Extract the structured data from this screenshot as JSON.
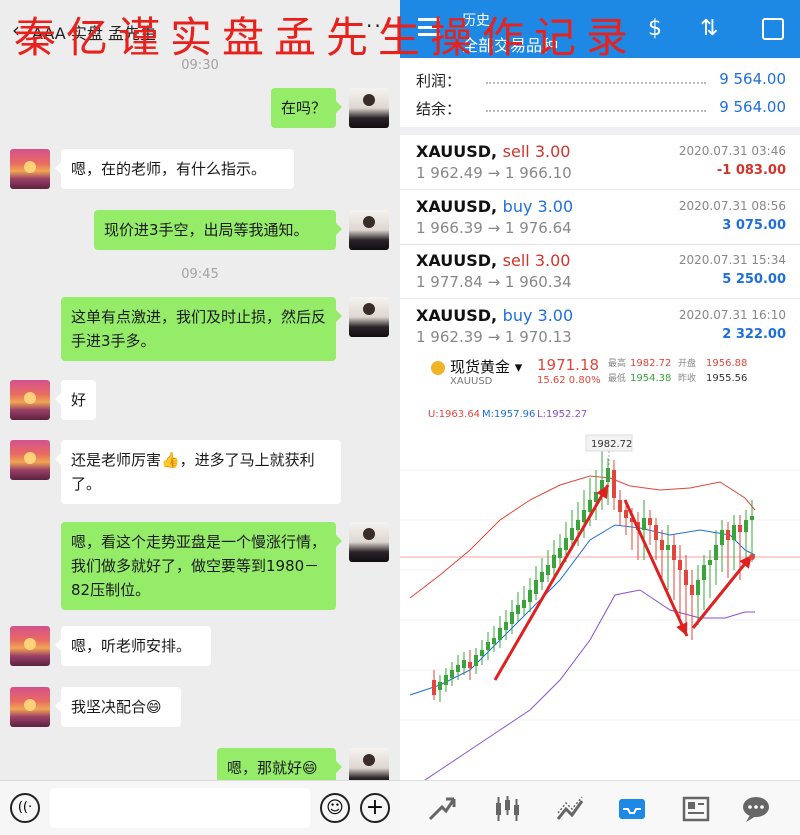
{
  "overlay_title": "秦亿谨实盘孟先生操作记录",
  "chat": {
    "title": "AAA 实盘 孟先生",
    "more": "···",
    "timestamps": [
      "09:30",
      "09:45"
    ],
    "messages": [
      {
        "side": "self",
        "text": "在吗？"
      },
      {
        "side": "other",
        "text": "嗯，在的老师，有什么指示。"
      },
      {
        "side": "self",
        "text": "现价进3手空，出局等我通知。"
      },
      {
        "side": "self",
        "text": "这单有点激进，我们及时止损，然后反手进3手多。"
      },
      {
        "side": "other",
        "text": "好"
      },
      {
        "side": "other",
        "text": "还是老师厉害👍，进多了马上就获利了。"
      },
      {
        "side": "self",
        "text": "嗯，看这个走势亚盘是一个慢涨行情，我们做多就好了，做空要等到1980－82压制位。"
      },
      {
        "side": "other",
        "text": "嗯，听老师安排。"
      },
      {
        "side": "other",
        "text": "我坚决配合😄"
      },
      {
        "side": "self",
        "text": "嗯，那就好😄"
      }
    ],
    "input": {
      "voice": "((·",
      "emoji": "☺",
      "plus": "+"
    }
  },
  "trade": {
    "header": {
      "title": "历史",
      "subtitle": "全部交易品种",
      "dollar": "$",
      "sort": "⇅"
    },
    "summary": [
      {
        "label": "利润：",
        "value": "9 564.00"
      },
      {
        "label": "结余：",
        "value": "9 564.00"
      }
    ],
    "rows": [
      {
        "symbol": "XAUUSD,",
        "side": "sell",
        "lots": "3.00",
        "open": "1 962.49",
        "close": "1 966.10",
        "date": "2020.07.31 03:46",
        "pl": "-1 083.00",
        "pl_sign": "neg"
      },
      {
        "symbol": "XAUUSD,",
        "side": "buy",
        "lots": "3.00",
        "open": "1 966.39",
        "close": "1 976.64",
        "date": "2020.07.31 08:56",
        "pl": "3 075.00",
        "pl_sign": "pos"
      },
      {
        "symbol": "XAUUSD,",
        "side": "sell",
        "lots": "3.00",
        "open": "1 977.84",
        "close": "1 960.34",
        "date": "2020.07.31 15:34",
        "pl": "5 250.00",
        "pl_sign": "pos"
      },
      {
        "symbol": "XAUUSD,",
        "side": "buy",
        "lots": "3.00",
        "open": "1 962.39",
        "close": "1 970.13",
        "date": "2020.07.31 16:10",
        "pl": "2 322.00",
        "pl_sign": "pos"
      }
    ],
    "quote": {
      "name": "现货黄金",
      "code": "XAUUSD",
      "price": "1971.18",
      "change": "15.62",
      "change_pct": "0.80%",
      "high_label": "最高",
      "high": "1982.72",
      "open_label": "开盘",
      "open": "1956.88",
      "low_label": "最低",
      "low": "1954.38",
      "prev_label": "昨收",
      "prev": "1955.56",
      "boll_u": "U:1963.64",
      "boll_m": "M:1957.96",
      "boll_l": "L:1952.27",
      "peak_label": "1982.72"
    },
    "tabs": [
      "trend-icon",
      "candles-icon",
      "chart-line-icon",
      "inbox-icon",
      "news-icon",
      "chat-icon"
    ],
    "colors": {
      "accent": "#1e88e5",
      "sell": "#d0342c",
      "buy": "#1e6fd9",
      "up": "#3aa43a",
      "down": "#e0463a"
    }
  }
}
